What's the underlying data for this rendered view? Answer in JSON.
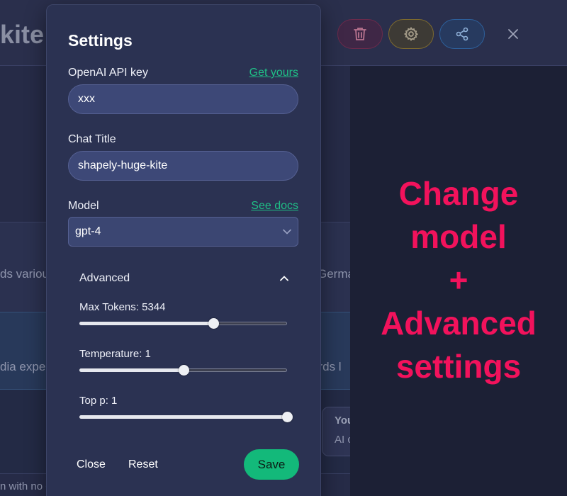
{
  "background": {
    "title_fragment": "kite",
    "left_fragments": [
      "ds variou",
      "dia expe"
    ],
    "right_fragments": [
      "Germa",
      "ords l"
    ],
    "mini_card": {
      "title": "You",
      "text": "AI c"
    },
    "footer_fragment": "n with no c"
  },
  "header": {
    "delete_icon": "trash-icon",
    "settings_icon": "gear-icon",
    "share_icon": "share-icon",
    "close_icon": "close-icon"
  },
  "settings": {
    "title": "Settings",
    "api_key": {
      "label": "OpenAI API key",
      "link": "Get yours",
      "value": "xxx"
    },
    "chat_title": {
      "label": "Chat Title",
      "value": "shapely-huge-kite"
    },
    "model": {
      "label": "Model",
      "link": "See docs",
      "selected": "gpt-4"
    },
    "advanced": {
      "label": "Advanced",
      "expanded": true,
      "max_tokens": {
        "label": "Max Tokens: 5344",
        "value": 5344,
        "fraction": 0.644
      },
      "temperature": {
        "label": "Temperature: 1",
        "value": 1,
        "fraction": 0.5
      },
      "top_p": {
        "label": "Top p: 1",
        "value": 1,
        "fraction": 1.0
      }
    },
    "buttons": {
      "close": "Close",
      "reset": "Reset",
      "save": "Save"
    }
  },
  "annotation": {
    "lines": [
      "Change",
      "model",
      "+",
      "Advanced",
      "settings"
    ],
    "color": "#f2125c"
  },
  "colors": {
    "accent": "#13b97a",
    "link": "#1fbf86",
    "modal_bg": "#2b3252"
  }
}
